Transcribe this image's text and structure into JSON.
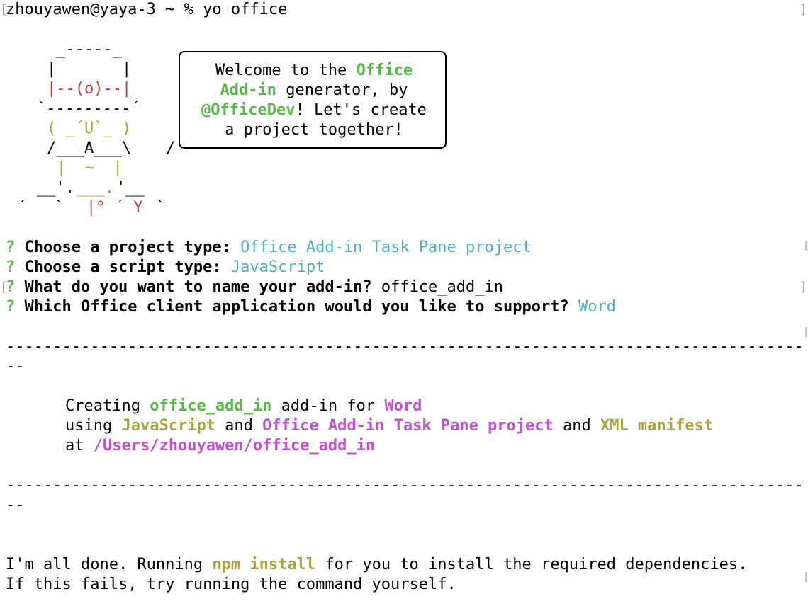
{
  "prompt": {
    "user_host": "zhouyawen@yaya-3",
    "cwd": "~",
    "symbol": "%",
    "command": "yo office"
  },
  "yeoman_art": {
    "hat_top": "_-----_",
    "hat_side": "|       |",
    "eyes": "|--(o)--|",
    "hat_brim": "`---------´",
    "face": "( _´U`_ )",
    "chin": "/___A___\\",
    "tail": "/",
    "body": "|  ~  |",
    "belt_left": "__'.",
    "belt_mid": "___.",
    "belt_right": "'__",
    "feet_left": "´   `",
    "feet_mid": "|° ´ Y",
    "feet_right": "`"
  },
  "welcome": {
    "line1_pre": "Welcome to the ",
    "line1_accent": "Office",
    "line2_accent": "Add-in",
    "line2_post": " generator, by",
    "line3_accent": "@OfficeDev",
    "line3_post": "! Let's create",
    "line4": "a project together!"
  },
  "questions": [
    {
      "mark": "?",
      "question": "Choose a project type:",
      "answer": "Office Add-in Task Pane project"
    },
    {
      "mark": "?",
      "question": "Choose a script type:",
      "answer": "JavaScript"
    },
    {
      "mark": "?",
      "question": "What do you want to name your add-in?",
      "answer": "office_add_in"
    },
    {
      "mark": "?",
      "question": "Which Office client application would you like to support?",
      "answer": "Word"
    }
  ],
  "separator": {
    "long": "--------------------------------------------------------------------------------------------------------",
    "wrap": "--"
  },
  "summary": {
    "w1": "Creating ",
    "name": "office_add_in",
    "w2": " add-in for ",
    "host": "Word",
    "w3": "using ",
    "script": "JavaScript",
    "w4": " and ",
    "project": "Office Add-in Task Pane project",
    "w5": " and ",
    "manifest": "XML manifest",
    "w6": "at ",
    "path": "/Users/zhouyawen/office_add_in"
  },
  "done": {
    "d1": "I'm all done. Running ",
    "npm": "npm install",
    "d2": " for you to install the required dependencies.",
    "d3": "If this fails, try running the command yourself."
  },
  "colors": {
    "green": "#5ab84a",
    "cyan": "#4fb0bf",
    "magenta": "#c350cf",
    "olive": "#a8a33a",
    "red": "#b5413a"
  }
}
